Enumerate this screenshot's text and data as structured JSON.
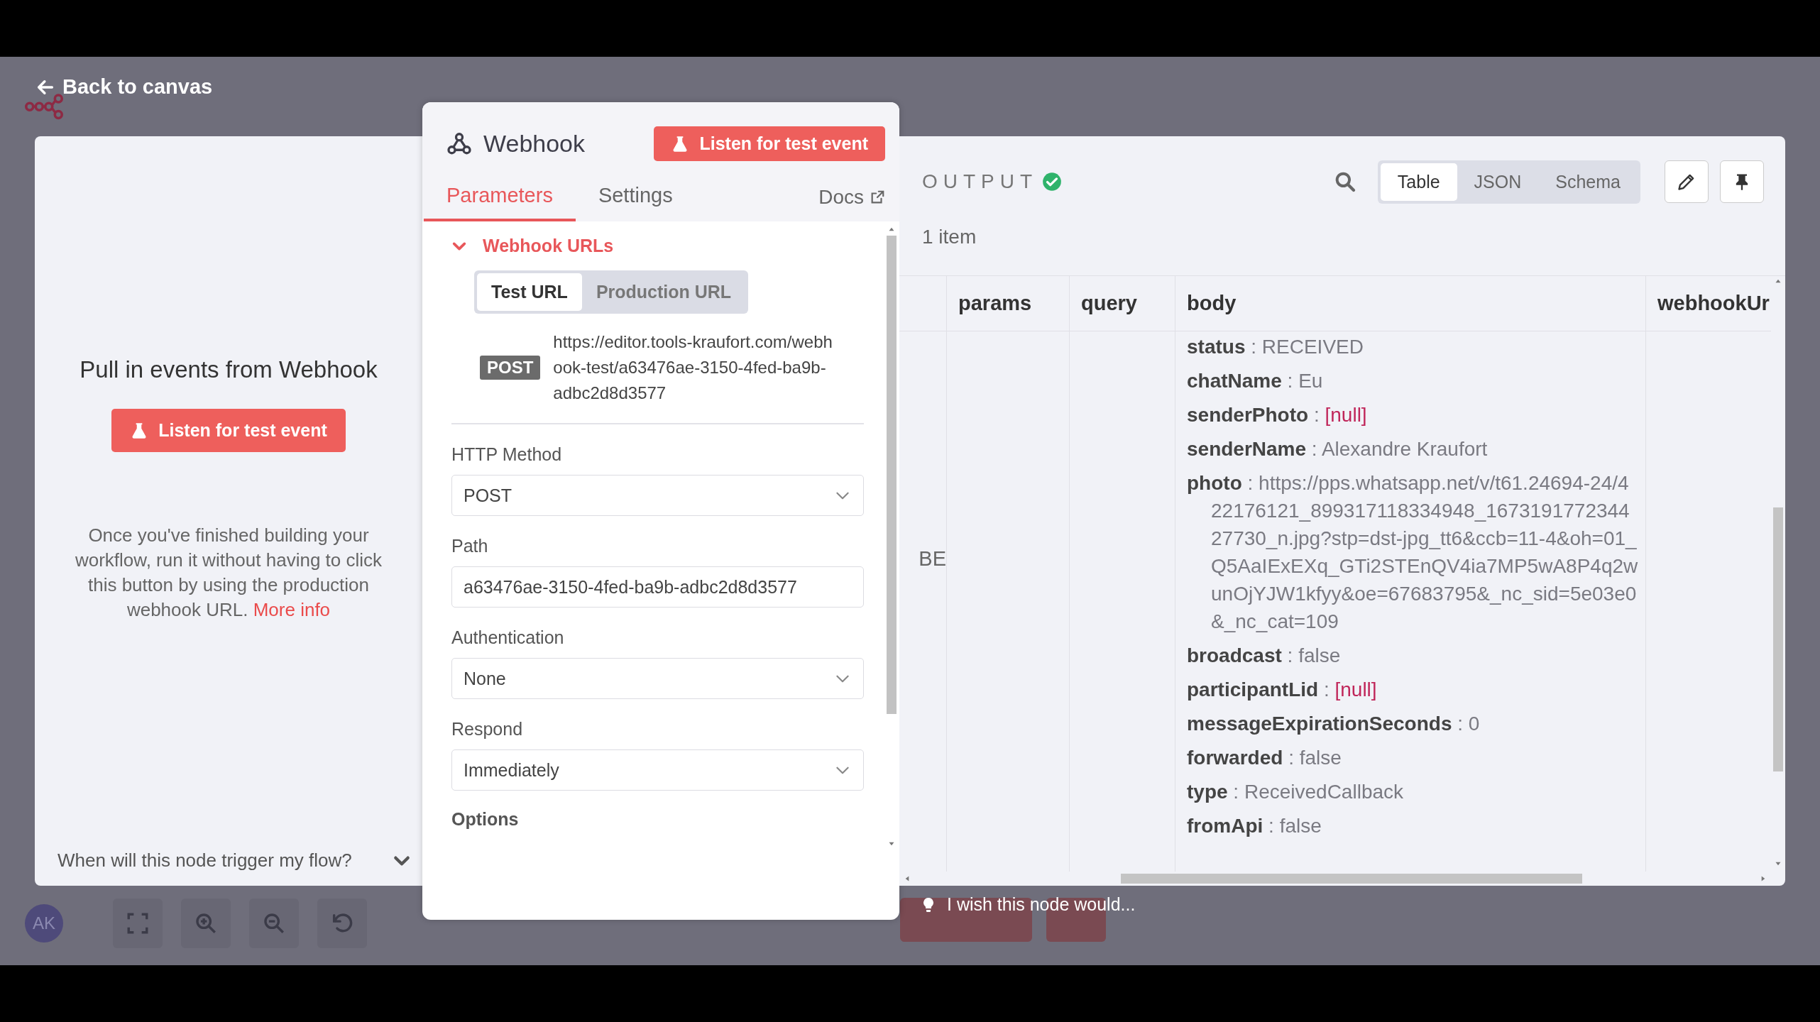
{
  "back_link": "Back to canvas",
  "trigger_panel": {
    "title": "Pull in events from Webhook",
    "button": "Listen for test event",
    "description": "Once you've finished building your workflow, run it without having to click this button by using the production webhook URL.",
    "more_info_link": "More info",
    "faq": {
      "question": "When will this node trigger my flow?",
      "expanded": false
    }
  },
  "node_panel": {
    "title": "Webhook",
    "listen_button": "Listen for test event",
    "tabs": [
      {
        "label": "Parameters",
        "selected": true
      },
      {
        "label": "Settings",
        "selected": false
      }
    ],
    "docs_link": "Docs",
    "webhook_urls": {
      "label": "Webhook URLs",
      "expanded": true,
      "url_tabs": [
        {
          "label": "Test URL",
          "selected": true
        },
        {
          "label": "Production URL",
          "selected": false
        }
      ],
      "method_badge": "POST",
      "url": "https://editor.tools-kraufort.com/webhook-test/a63476ae-3150-4fed-ba9b-adbc2d8d3577"
    },
    "fields": [
      {
        "kind": "select",
        "label": "HTTP Method",
        "value": "POST"
      },
      {
        "kind": "input",
        "label": "Path",
        "value": "a63476ae-3150-4fed-ba9b-adbc2d8d3577"
      },
      {
        "kind": "select",
        "label": "Authentication",
        "value": "None"
      },
      {
        "kind": "select",
        "label": "Respond",
        "value": "Immediately"
      }
    ],
    "options_label": "Options"
  },
  "output_panel": {
    "title": "OUTPUT",
    "success": true,
    "view_tabs": [
      {
        "label": "Table",
        "selected": true
      },
      {
        "label": "JSON",
        "selected": false
      },
      {
        "label": "Schema",
        "selected": false
      }
    ],
    "item_count": "1 item",
    "table": {
      "columns": [
        "params",
        "query",
        "body",
        "webhookUr"
      ],
      "key_separator": ":",
      "rows": [
        {
          "column_1": "BE",
          "body": [
            {
              "key": "status",
              "value": "RECEIVED",
              "kind": "text"
            },
            {
              "key": "chatName",
              "value": "Eu",
              "kind": "text"
            },
            {
              "key": "senderPhoto",
              "value": "[null]",
              "kind": "null"
            },
            {
              "key": "senderName",
              "value": "Alexandre Kraufort",
              "kind": "text"
            },
            {
              "key": "photo",
              "value": "https://pps.whatsapp.net/v/t61.24694-24/422176121_899317118334948_167319177234427730_n.jpg?stp=dst-jpg_tt6&ccb=11-4&oh=01_Q5AaIExEXq_GTi2STEnQV4ia7MP5wA8P4q2wunOjYJW1kfyy&oe=67683795&_nc_sid=5e03e0&_nc_cat=109",
              "kind": "text"
            },
            {
              "key": "broadcast",
              "value": "false",
              "kind": "text"
            },
            {
              "key": "participantLid",
              "value": "[null]",
              "kind": "null"
            },
            {
              "key": "messageExpirationSeconds",
              "value": "0",
              "kind": "text"
            },
            {
              "key": "forwarded",
              "value": "false",
              "kind": "text"
            },
            {
              "key": "type",
              "value": "ReceivedCallback",
              "kind": "text"
            },
            {
              "key": "fromApi",
              "value": "false",
              "kind": "text"
            }
          ]
        }
      ]
    }
  },
  "feedback_prompt": "I wish this node would...",
  "user_avatar": "AK"
}
